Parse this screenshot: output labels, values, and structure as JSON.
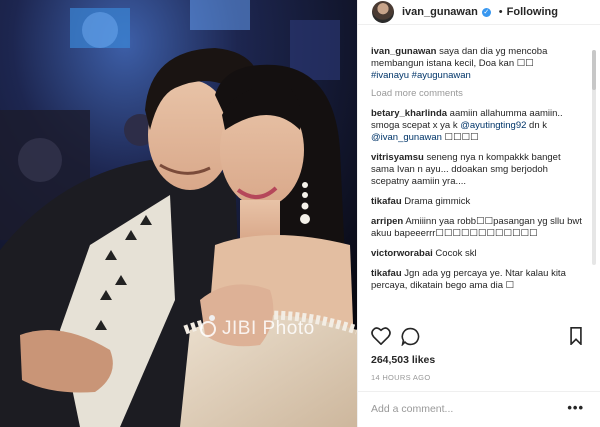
{
  "post": {
    "username": "ivan_gunawan",
    "separator": "•",
    "follow_label": "Following",
    "caption_user": "ivan_gunawan",
    "caption_text": " saya dan dia yg mencoba membangun istana kecil, Doa kan ",
    "caption_emoji": "☐☐",
    "caption_tags": "#ivanayu #ayugunawan",
    "load_more": "Load more comments",
    "likes": "264,503 likes",
    "timestamp": "14 HOURS AGO",
    "add_comment_placeholder": "Add a comment...",
    "more_label": "•••",
    "watermark": "JIBI Photo"
  },
  "comments": [
    {
      "user": "betary_kharlinda",
      "text": " aamiin allahumma aamiin.. smoga scepat x ya k ",
      "mention1": "@ayutingting92",
      "mid": " dn k ",
      "mention2": "@ivan_gunawan",
      "tail": " ☐☐☐☐"
    },
    {
      "user": "vitrisyamsu",
      "text": " seneng nya n kompakkk banget sama Ivan n ayu... ddoakan smg berjodoh scepatny aamiin yra...."
    },
    {
      "user": "tikafau",
      "text": " Drama gimmick"
    },
    {
      "user": "arripen",
      "text": " Amiiinn yaa robb☐☐pasangan yg sllu bwt akuu bapeeerrr☐☐☐☐☐☐☐☐☐☐☐☐"
    },
    {
      "user": "victorworabai",
      "text": " Cocok skl"
    },
    {
      "user": "tikafau",
      "text": " Jgn ada yg percaya ye. Ntar kalau kita percaya, dikatain bego ama dia ☐"
    }
  ],
  "icons": {
    "like": "heart-icon",
    "comment": "speech-bubble-icon",
    "save": "bookmark-icon",
    "verified": "verified-badge-icon"
  },
  "colors": {
    "link": "#003569",
    "verified": "#3897f0",
    "muted": "#999999"
  }
}
